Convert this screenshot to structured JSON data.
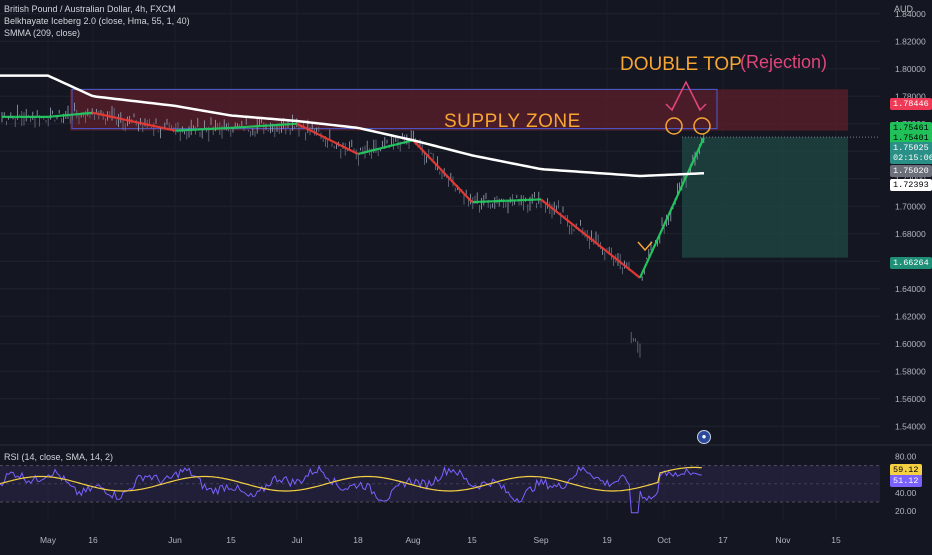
{
  "header": {
    "symbol_line": "British Pound / Australian Dollar, 4h, FXCM",
    "indicator1": "Belkhayate Iceberg 2.0 (close, Hma, 55, 1, 40)",
    "indicator2": "SMMA (209, close)",
    "currency": "AUD"
  },
  "rsi": {
    "label": "RSI (14, close, SMA, 14, 2)",
    "value_label": "59.12",
    "sma_label": "51.12",
    "ticks": [
      "80.00",
      "60.00",
      "40.00",
      "20.00"
    ]
  },
  "annotations": {
    "supply_zone": "SUPPLY ZONE",
    "double_top": "DOUBLE TOP",
    "rejection": "(Rejection)"
  },
  "price_labels": {
    "zone_top": "1.78446",
    "green_a": "1.75461",
    "green_b": "1.75401",
    "last": "1.75025",
    "countdown": "02:15:06",
    "entry": "1.75020",
    "smma": "1.72393",
    "target": "1.66264"
  },
  "colors": {
    "background": "#141721",
    "supply_zone": "#5c1f2a",
    "bull": "#22c55e",
    "bear": "#e53935",
    "smma": "#ffffff",
    "target_zone": "#1d4a44",
    "annotation_orange": "#f7a533",
    "annotation_pink": "#e0457b",
    "rsi_line": "#7b61ff",
    "rsi_sma": "#f5d142"
  },
  "chart_data": {
    "type": "line",
    "title": "British Pound / Australian Dollar, 4h, FXCM",
    "y_ticks": [
      "1.84000",
      "1.82000",
      "1.80000",
      "1.78000",
      "1.76000",
      "1.74000",
      "1.72000",
      "1.70000",
      "1.68000",
      "1.66000",
      "1.64000",
      "1.62000",
      "1.60000",
      "1.58000",
      "1.56000",
      "1.54000"
    ],
    "x_ticks": [
      "May",
      "16",
      "Jun",
      "15",
      "Jul",
      "18",
      "Aug",
      "15",
      "Sep",
      "19",
      "Oct",
      "17",
      "Nov",
      "15"
    ],
    "ylim": [
      1.53,
      1.85
    ],
    "series": [
      {
        "x": [
          "May",
          "16",
          "Jun",
          "15",
          "Jul",
          "18",
          "Aug",
          "15",
          "Sep",
          "19",
          "Oct"
        ],
        "values": [
          1.765,
          1.768,
          1.755,
          1.757,
          1.76,
          1.738,
          1.748,
          1.703,
          1.705,
          1.648,
          1.75
        ]
      },
      {
        "name": "SMMA (209, close)",
        "x": [
          "May",
          "16",
          "Jun",
          "15",
          "Jul",
          "18",
          "Aug",
          "15",
          "Sep",
          "19",
          "Oct"
        ],
        "values": [
          1.795,
          1.78,
          1.773,
          1.766,
          1.762,
          1.757,
          1.748,
          1.737,
          1.727,
          1.722,
          1.724
        ]
      }
    ],
    "supply_zone": [
      1.755,
      1.785
    ],
    "rsi": {
      "ylim": [
        10,
        85
      ],
      "bands": [
        70,
        30
      ],
      "last": 59.12,
      "sma_last": 51.12
    }
  }
}
